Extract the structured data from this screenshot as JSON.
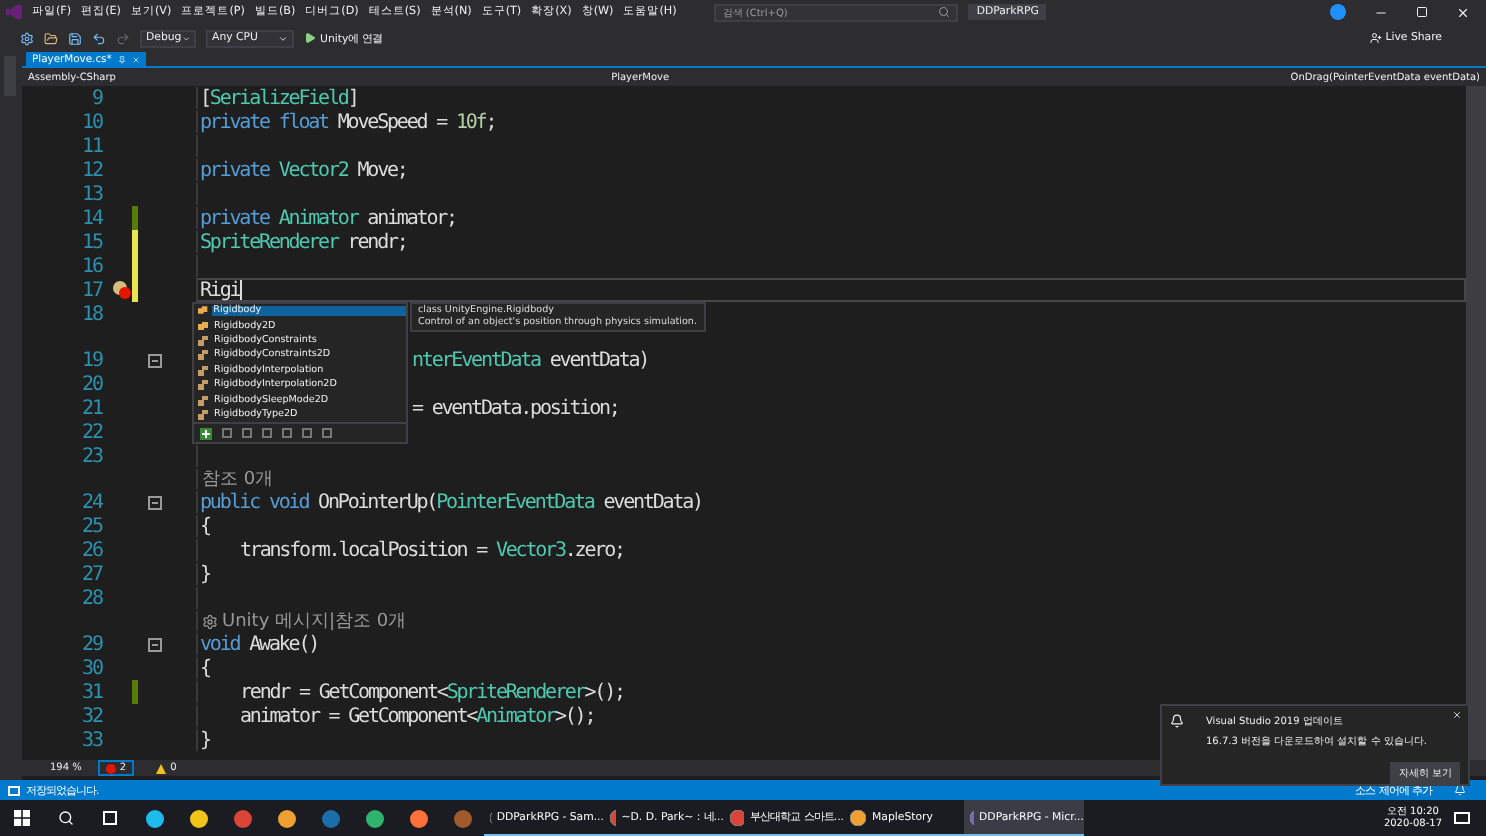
{
  "menu": [
    "파일(F)",
    "편집(E)",
    "보기(V)",
    "프로젝트(P)",
    "빌드(B)",
    "디버그(D)",
    "테스트(S)",
    "분석(N)",
    "도구(T)",
    "확장(X)",
    "창(W)",
    "도움말(H)"
  ],
  "search": {
    "placeholder": "검색 (Ctrl+Q)"
  },
  "solution_name": "DDParkRPG",
  "toolbar": {
    "configuration": "Debug",
    "platform": "Any CPU",
    "attach": "Unity에 연결",
    "live_share": "Live Share"
  },
  "tabs": [
    {
      "label": "PlayerMove.cs*",
      "selected": true
    }
  ],
  "navbar": {
    "project": "Assembly-CSharp",
    "type": "PlayerMove",
    "member": "OnDrag(PointerEventData eventData)"
  },
  "lines": [
    {
      "kind": "code",
      "number": "9",
      "tokens": [
        {
          "text": "[",
          "kind": "plain"
        },
        {
          "text": "SerializeField",
          "kind": "type"
        },
        {
          "text": "]",
          "kind": "plain"
        }
      ]
    },
    {
      "kind": "code",
      "number": "10",
      "tokens": [
        {
          "text": "private float",
          "kind": "keyword"
        },
        {
          "text": " MoveSpeed = ",
          "kind": "plain"
        },
        {
          "text": "10f",
          "kind": "number"
        },
        {
          "text": ";",
          "kind": "plain"
        }
      ]
    },
    {
      "kind": "code",
      "number": "11"
    },
    {
      "kind": "code",
      "number": "12",
      "tokens": [
        {
          "text": "private",
          "kind": "keyword"
        },
        {
          "text": " Vector2",
          "kind": "type"
        },
        {
          "text": " Move;",
          "kind": "plain"
        }
      ]
    },
    {
      "kind": "code",
      "number": "13"
    },
    {
      "kind": "code",
      "number": "14",
      "changed": true,
      "saved": true,
      "tokens": [
        {
          "text": "private",
          "kind": "keyword"
        },
        {
          "text": " Animator",
          "kind": "type"
        },
        {
          "text": " animator;",
          "kind": "plain"
        }
      ]
    },
    {
      "kind": "code",
      "number": "15",
      "changed": true,
      "saved": false,
      "tokens": [
        {
          "text": "SpriteRenderer",
          "kind": "type"
        },
        {
          "text": " rendr;",
          "kind": "plain"
        }
      ]
    },
    {
      "kind": "code",
      "number": "16",
      "changed": true,
      "saved": false
    },
    {
      "kind": "code",
      "number": "17",
      "changed": true,
      "saved": false,
      "current": true,
      "error": true,
      "tokens": [
        {
          "text": "Rigi",
          "kind": "plain"
        }
      ]
    },
    {
      "kind": "code",
      "number": "18"
    },
    {
      "kind": "lens"
    },
    {
      "kind": "code",
      "number": "19",
      "fold": true,
      "after_popup": true,
      "tokens": [
        {
          "text": "nterEventData",
          "kind": "type"
        },
        {
          "text": " eventData)",
          "kind": "plain"
        }
      ]
    },
    {
      "kind": "code",
      "number": "20"
    },
    {
      "kind": "code",
      "number": "21",
      "after_popup": true,
      "tokens": [
        {
          "text": "= eventData.position;",
          "kind": "plain"
        }
      ]
    },
    {
      "kind": "code",
      "number": "22"
    },
    {
      "kind": "code",
      "number": "23"
    },
    {
      "kind": "lens",
      "text": "참조 0개"
    },
    {
      "kind": "code",
      "number": "24",
      "fold": true,
      "tokens": [
        {
          "text": "public void",
          "kind": "keyword"
        },
        {
          "text": " OnPointerUp(",
          "kind": "plain"
        },
        {
          "text": "PointerEventData",
          "kind": "type"
        },
        {
          "text": " eventData)",
          "kind": "plain"
        }
      ]
    },
    {
      "kind": "code",
      "number": "25",
      "tokens": [
        {
          "text": "{",
          "kind": "plain"
        }
      ]
    },
    {
      "kind": "code",
      "number": "26",
      "indented": true,
      "tokens": [
        {
          "text": "transform.localPosition = ",
          "kind": "plain"
        },
        {
          "text": "Vector3",
          "kind": "type"
        },
        {
          "text": ".zero;",
          "kind": "plain"
        }
      ]
    },
    {
      "kind": "code",
      "number": "27",
      "tokens": [
        {
          "text": "}",
          "kind": "plain"
        }
      ]
    },
    {
      "kind": "code",
      "number": "28"
    },
    {
      "kind": "lens",
      "unity": true,
      "text": "Unity 메시지|참조 0개"
    },
    {
      "kind": "code",
      "number": "29",
      "fold": true,
      "tokens": [
        {
          "text": "void",
          "kind": "keyword"
        },
        {
          "text": " Awake()",
          "kind": "plain"
        }
      ]
    },
    {
      "kind": "code",
      "number": "30",
      "tokens": [
        {
          "text": "{",
          "kind": "plain"
        }
      ]
    },
    {
      "kind": "code",
      "number": "31",
      "changed": true,
      "saved": true,
      "indented": true,
      "tokens": [
        {
          "text": "rendr = GetComponent<",
          "kind": "plain"
        },
        {
          "text": "SpriteRenderer",
          "kind": "type"
        },
        {
          "text": ">();",
          "kind": "plain"
        }
      ]
    },
    {
      "kind": "code",
      "number": "32",
      "indented": true,
      "tokens": [
        {
          "text": "animator = GetComponent<",
          "kind": "plain"
        },
        {
          "text": "Animator",
          "kind": "type"
        },
        {
          "text": ">();",
          "kind": "plain"
        }
      ]
    },
    {
      "kind": "code",
      "number": "33",
      "tokens": [
        {
          "text": "}",
          "kind": "plain"
        }
      ]
    }
  ],
  "completion": {
    "items": [
      {
        "label": "Rigidbody",
        "kind": "class",
        "selected": true
      },
      {
        "label": "Rigidbody2D",
        "kind": "class",
        "selected": false
      },
      {
        "label": "RigidbodyConstraints",
        "kind": "enum",
        "selected": false
      },
      {
        "label": "RigidbodyConstraints2D",
        "kind": "enum",
        "selected": false
      },
      {
        "label": "RigidbodyInterpolation",
        "kind": "enum",
        "selected": false
      },
      {
        "label": "RigidbodyInterpolation2D",
        "kind": "enum",
        "selected": false
      },
      {
        "label": "RigidbodySleepMode2D",
        "kind": "enum",
        "selected": false
      },
      {
        "label": "RigidbodyType2D",
        "kind": "enum",
        "selected": false
      }
    ],
    "tooltip": {
      "signature": "class UnityEngine.Rigidbody",
      "description": "Control of an object's position through physics simulation."
    }
  },
  "editor_status": {
    "zoom": "194 %",
    "errors": "2",
    "warnings": "0"
  },
  "status_bar": {
    "message": "저장되었습니다.",
    "source_control": "소스 제어에 추가"
  },
  "notification": {
    "title": "Visual Studio 2019 업데이트",
    "body": "16.7.3 버전을 다운로드하여 설치할 수 있습니다.",
    "button": "자세히 보기"
  },
  "taskbar": {
    "apps": [
      {
        "label": "DDParkRPG - Sam...",
        "kind": "unity",
        "selected": false
      },
      {
        "label": "~D. D. Park~ : 네...",
        "kind": "chrome",
        "selected": false
      },
      {
        "label": "부산대학교 스마트...",
        "kind": "chrome",
        "selected": false
      },
      {
        "label": "MapleStory",
        "kind": "maple",
        "selected": false
      },
      {
        "label": "DDParkRPG - Micr...",
        "kind": "vs",
        "selected": true
      }
    ],
    "time": "오전 10:20",
    "date": "2020-08-17"
  }
}
